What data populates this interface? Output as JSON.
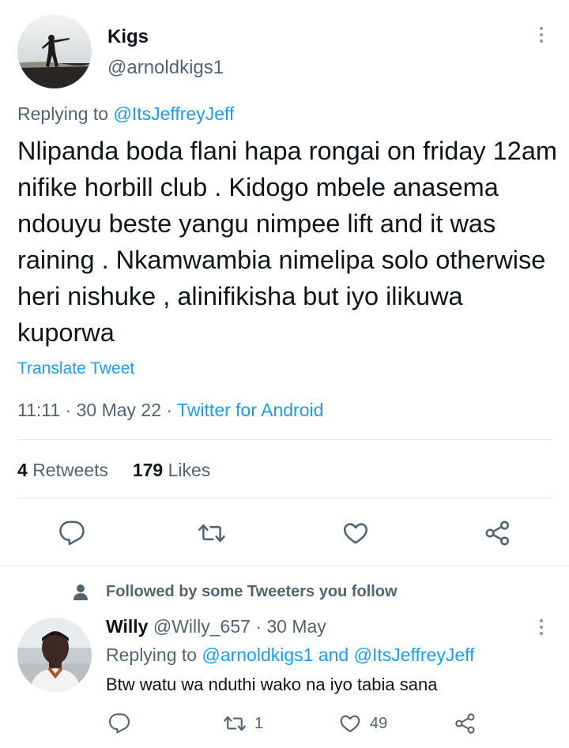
{
  "tweet": {
    "author_name": "Kigs",
    "author_handle": "@arnoldkigs1",
    "replying_prefix": "Replying to ",
    "replying_to": "@ItsJeffreyJeff",
    "text": "Nlipanda boda flani hapa rongai on friday 12am nifike horbill club . Kidogo mbele anasema ndouyu beste yangu nimpee lift and it was raining . Nkamwambia nimelipa solo otherwise heri nishuke , alinifikisha but iyo ilikuwa kuporwa",
    "translate_label": "Translate Tweet",
    "time": "11:11",
    "date": "30 May 22",
    "source": "Twitter for Android",
    "retweets_count": "4",
    "retweets_label": "Retweets",
    "likes_count": "179",
    "likes_label": "Likes",
    "icons": [
      "reply-icon",
      "retweet-icon",
      "like-icon",
      "share-icon",
      "more-icon"
    ]
  },
  "reply_section": {
    "followed_label": "Followed by some Tweeters you follow",
    "followed_icon": "person-icon"
  },
  "reply": {
    "author_name": "Willy",
    "author_handle": "@Willy_657",
    "date": "30 May",
    "replying_prefix": "Replying to ",
    "replying_to_1": "@arnoldkigs1",
    "replying_and": " and ",
    "replying_to_2": "@ItsJeffreyJeff",
    "text": "Btw watu wa nduthi wako na iyo tabia sana",
    "retweet_count": "1",
    "like_count": "49"
  },
  "colors": {
    "link": "#1d9bf0",
    "secondary_text": "#536471",
    "primary_text": "#0f1419",
    "divider": "#e1e6ea"
  }
}
